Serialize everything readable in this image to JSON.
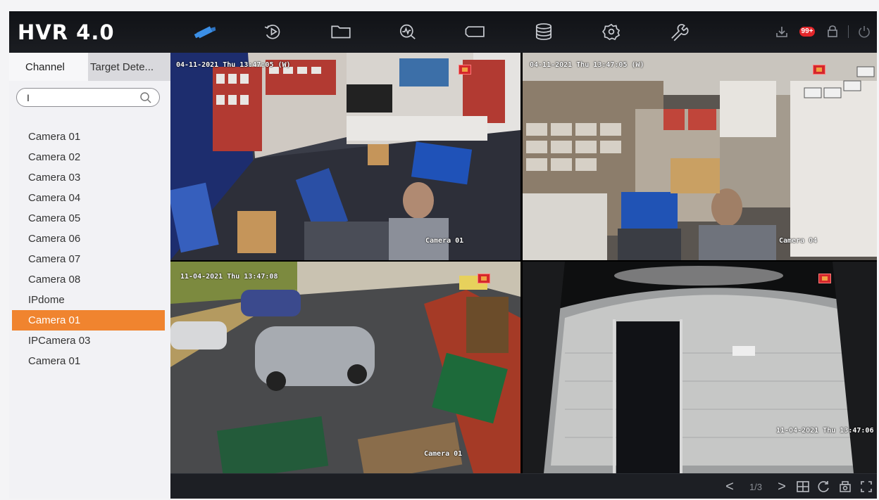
{
  "app": {
    "brand": "HVR 4.0"
  },
  "toolbar": {
    "nav": [
      {
        "name": "live-view-icon"
      },
      {
        "name": "playback-icon"
      },
      {
        "name": "file-management-icon"
      },
      {
        "name": "smart-analysis-icon"
      },
      {
        "name": "configuration-display-icon"
      },
      {
        "name": "storage-icon"
      },
      {
        "name": "settings-icon"
      },
      {
        "name": "maintenance-icon"
      }
    ],
    "tray": {
      "download_icon": "download-icon",
      "alarm_badge": "99+",
      "lock_icon": "lock-icon",
      "power_icon": "power-icon"
    }
  },
  "sidebar": {
    "tabs": [
      {
        "label": "Channel"
      },
      {
        "label": "Target Dete..."
      }
    ],
    "search": {
      "value": "I",
      "placeholder": ""
    },
    "cameras": [
      {
        "label": "Camera 01",
        "selected": false
      },
      {
        "label": "Camera 02",
        "selected": false
      },
      {
        "label": "Camera 03",
        "selected": false
      },
      {
        "label": "Camera 04",
        "selected": false
      },
      {
        "label": "Camera 05",
        "selected": false
      },
      {
        "label": "Camera 06",
        "selected": false
      },
      {
        "label": "Camera 07",
        "selected": false
      },
      {
        "label": "Camera 08",
        "selected": false
      },
      {
        "label": "IPdome",
        "selected": false
      },
      {
        "label": "Camera 01",
        "selected": true
      },
      {
        "label": "IPCamera 03",
        "selected": false
      },
      {
        "label": "Camera 01",
        "selected": false
      }
    ]
  },
  "tiles": [
    {
      "timestamp": "04-11-2021 Thu 13:47:05 (W)",
      "label": "Camera 01"
    },
    {
      "timestamp": "04-11-2021 Thu 13:47:05 (W)",
      "label": "Camera 04"
    },
    {
      "timestamp": "11-04-2021 Thu 13:47:08",
      "label": "Camera 01"
    },
    {
      "timestamp": "11-04-2021 Thu 13:47:06",
      "label": ""
    }
  ],
  "pager": {
    "page": "1/3",
    "prev": "<",
    "next": ">"
  },
  "colors": {
    "accent": "#f0842f",
    "alarm": "#e2262a",
    "background": "#15171c"
  }
}
